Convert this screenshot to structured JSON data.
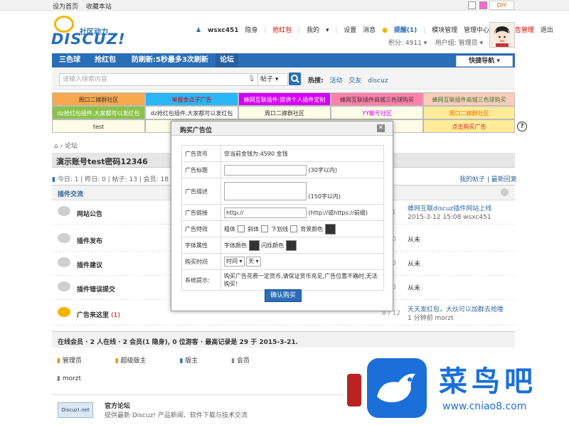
{
  "topbar": {
    "set_home": "设为首页",
    "bookmark": "收藏本站",
    "diy": "DIY"
  },
  "logo": {
    "main": "DISCUZ!",
    "sub": "社区动力"
  },
  "usernav": {
    "username": "wsxc451",
    "hidden": "隐身",
    "redpack": "抢红包",
    "mine": "我的",
    "settings": "设置",
    "messages": "消息",
    "reminders": "提醒(1)",
    "module_mgmt": "模块管理",
    "admin_center": "管理中心",
    "ad_mgmt": "个人广告管理",
    "logout": "退出"
  },
  "userinfo": {
    "points": "积分: 4911",
    "group": "用户组: 管理员"
  },
  "nav": {
    "items": [
      "三色球",
      "抢红包",
      "防刷新:5秒最多3次刷新",
      "论坛"
    ],
    "quick": "快捷导航"
  },
  "search": {
    "placeholder": "请输入搜索内容",
    "type": "帖子",
    "hot_label": "热搜:",
    "hot": [
      "活动",
      "交友",
      "discuz"
    ]
  },
  "ads": [
    {
      "text": "周口二嫁群社区",
      "bg": "#f7a94c",
      "color": "#333"
    },
    {
      "text": "举报金点子广告",
      "bg": "#29b6f6",
      "color": "#c00"
    },
    {
      "text": "蜂网互联插件:提供个人插件定制",
      "bg": "#d500f9",
      "color": "#fff"
    },
    {
      "text": "蜂网互联插件商城三色球购买",
      "bg": "#ff80ab",
      "color": "#333"
    },
    {
      "text": "蜂网互联插件商城三色球购买",
      "bg": "#ffccbc",
      "color": "#2e7d32"
    },
    {
      "text": "dz抢红包插件,大家都可以发红包",
      "bg": "#8bc34a",
      "color": "#fff"
    },
    {
      "text": "dz抢红包插件,大家都可以发红包",
      "bg": "#fff",
      "color": "#333"
    },
    {
      "text": "周口二嫁群社区",
      "bg": "#fffde7",
      "color": "#333"
    },
    {
      "text": "YY靓号社区",
      "bg": "#fffde7",
      "color": "#d500f9"
    },
    {
      "text": "周口二嫁群社区",
      "bg": "#ffeb99",
      "color": "#ef6c00"
    },
    {
      "text": "test",
      "bg": "#fffde7",
      "color": "#333"
    },
    {
      "text": "",
      "bg": "#fffde7",
      "color": "#333"
    },
    {
      "text": "点击购买广告",
      "bg": "#ffeb99",
      "color": "#d32f2f"
    }
  ],
  "breadcrumb": "论坛",
  "forum_title": "演示账号test密码12346",
  "stats": "今日: 1 | 昨日: 0 | 帖子: 13 | 会员: 18",
  "stats_links": "我的帖子 | 最新回复",
  "category": "插件交流",
  "forums": [
    {
      "name": "网站公告",
      "count": "/ 1",
      "last1": "蜂网互联discuz插件网站上线",
      "last2": "2015-3-12 15:08 wsxc451"
    },
    {
      "name": "插件发布",
      "count": "/ 0",
      "last1": "从未",
      "last2": ""
    },
    {
      "name": "插件建议",
      "count": "/ 0",
      "last1": "从未",
      "last2": ""
    },
    {
      "name": "插件错误提交",
      "count": "/ 0",
      "last1": "从未",
      "last2": ""
    },
    {
      "name": "广告来这里",
      "extra": "(1)",
      "count": "8 / 12",
      "last1": "天天发红包，大伙可以加群去抢喽",
      "last2": "1 分钟前 morzt"
    }
  ],
  "online": "在线会员 · 2 人在线 · 2 会员(1 隐身), 0 位游客 · 最高记录是 29 于 2015-3-21.",
  "roles": [
    "管理员",
    "超级版主",
    "版主",
    "会员"
  ],
  "online_member": "morzt",
  "official": {
    "logo": "Discuz!.net",
    "title": "官方论坛",
    "desc": "提供最新 Discuz! 产品新闻、软件下载与技术交流"
  },
  "watermark": {
    "title": "菜鸟吧",
    "url": "www.cniao8.com"
  },
  "modal": {
    "title": "购买广告位",
    "close": "✕",
    "rows": {
      "currency_label": "广告货币",
      "currency_value": "您当前金钱为:4590 金钱",
      "title_label": "广告标题",
      "title_hint": "(30字以内)",
      "desc_label": "广告描述",
      "desc_hint": "(150字以内)",
      "link_label": "广告链接",
      "link_value": "http://",
      "link_hint": "(http://或https://前缀)",
      "effect_label": "广告特效",
      "bold": "粗体",
      "italic": "斜体",
      "underline": "下划线",
      "bgcolor": "背景颜色",
      "font_label": "字体属性",
      "font_color": "字体颜色",
      "blink_color": "闪烁颜色",
      "time_label": "购买时间",
      "time_value": "时间",
      "time_unit": "天",
      "tip_label": "系统提示:",
      "tip_value": "购买广告花费一定货币,请保证货币充足,广告位置不确时,无法购买!"
    },
    "submit": "确认购买"
  }
}
